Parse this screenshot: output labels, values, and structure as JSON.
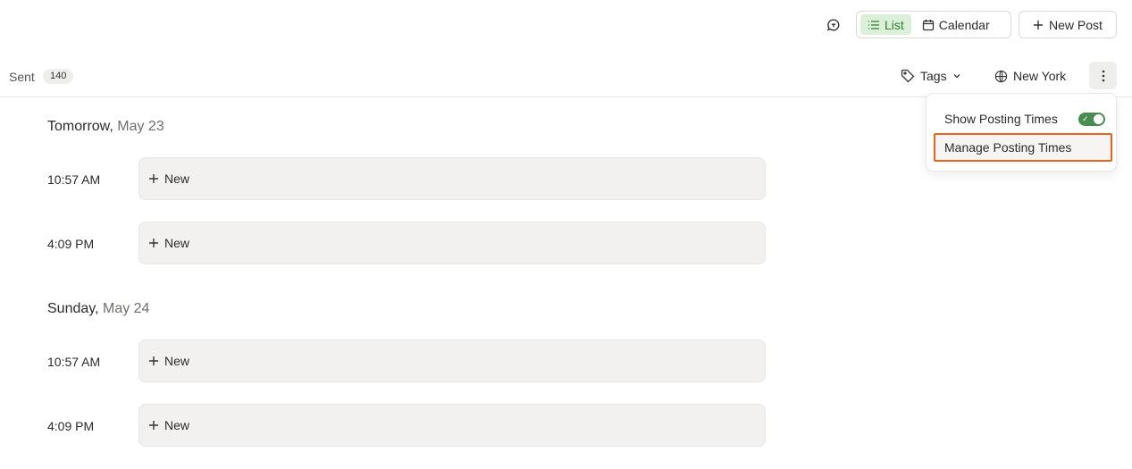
{
  "topbar": {
    "view_list_label": "List",
    "view_calendar_label": "Calendar",
    "new_post_label": "New Post",
    "active_view": "list"
  },
  "filterbar": {
    "sent_label": "Sent",
    "sent_count": "140",
    "tags_label": "Tags",
    "timezone_label": "New York"
  },
  "menu": {
    "show_posting_times_label": "Show Posting Times",
    "show_posting_times_enabled": true,
    "manage_posting_times_label": "Manage Posting Times"
  },
  "days": [
    {
      "weekday": "Tomorrow,",
      "date": "May 23",
      "slots": [
        {
          "time": "10:57 AM",
          "action": "New"
        },
        {
          "time": "4:09 PM",
          "action": "New"
        }
      ]
    },
    {
      "weekday": "Sunday,",
      "date": "May 24",
      "slots": [
        {
          "time": "10:57 AM",
          "action": "New"
        },
        {
          "time": "4:09 PM",
          "action": "New"
        }
      ]
    }
  ],
  "colors": {
    "accent_green": "#2e7d32",
    "active_bg": "#dcefd9",
    "highlight_orange": "#e8641c",
    "toggle_green": "#4a8b52"
  }
}
